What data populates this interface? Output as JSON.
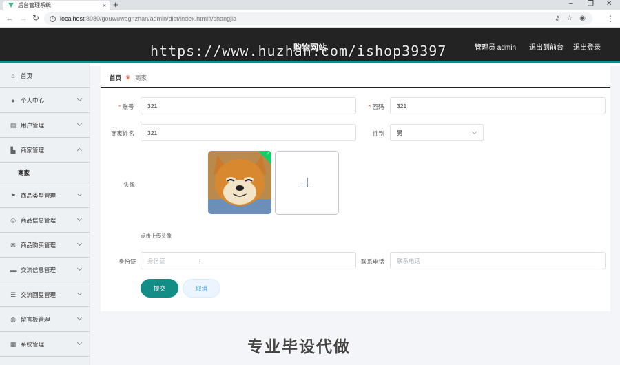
{
  "browser": {
    "tab_title": "后台管理系统",
    "tab_close": "×",
    "new_tab": "+",
    "url_host": "localhost",
    "url_path": ":8080/gouwuwagnzhan/admin/dist/index.html#/shangjia",
    "win_min": "–",
    "win_restore": "❐",
    "win_close": "✕"
  },
  "header": {
    "site_title": "购物网站",
    "user_label": "管理员 admin",
    "to_front": "退出到前台",
    "logout": "退出登录"
  },
  "watermark": {
    "url": "https://www.huzhan.com/ishop39397",
    "bottom": "专业毕设代做"
  },
  "sidebar": {
    "items": [
      {
        "label": "首页",
        "icon": "home-icon",
        "glyph": "⌂"
      },
      {
        "label": "个人中心",
        "icon": "user-icon",
        "glyph": "●"
      },
      {
        "label": "用户管理",
        "icon": "user-manage-icon",
        "glyph": "▤"
      },
      {
        "label": "商家管理",
        "icon": "shop-icon",
        "glyph": "▙"
      },
      {
        "label": "商家",
        "icon": "",
        "glyph": ""
      },
      {
        "label": "商品类型管理",
        "icon": "flag-icon",
        "glyph": "⚑"
      },
      {
        "label": "商品信息管理",
        "icon": "compass-icon",
        "glyph": "◎"
      },
      {
        "label": "商品购买管理",
        "icon": "mail-icon",
        "glyph": "✉"
      },
      {
        "label": "交流信息管理",
        "icon": "chat-icon",
        "glyph": "▬"
      },
      {
        "label": "交流回复管理",
        "icon": "sliders-icon",
        "glyph": "☰"
      },
      {
        "label": "留言板管理",
        "icon": "globe-icon",
        "glyph": "◍"
      },
      {
        "label": "系统管理",
        "icon": "grid-icon",
        "glyph": "▦"
      }
    ]
  },
  "breadcrumb": {
    "home": "首页",
    "current": "商家"
  },
  "form": {
    "account_label": "账号",
    "account_value": "321",
    "password_label": "密码",
    "password_value": "321",
    "name_label": "商家姓名",
    "name_value": "321",
    "gender_label": "性别",
    "gender_value": "男",
    "avatar_label": "头像",
    "upload_tip": "点击上传头像",
    "id_label": "身份证",
    "id_placeholder": "身份证",
    "phone_label": "联系电话",
    "phone_placeholder": "联系电话",
    "submit": "提交",
    "cancel": "取消"
  },
  "colors": {
    "accent": "#138e86",
    "header_bg": "#232323",
    "required": "#f56c6c"
  }
}
